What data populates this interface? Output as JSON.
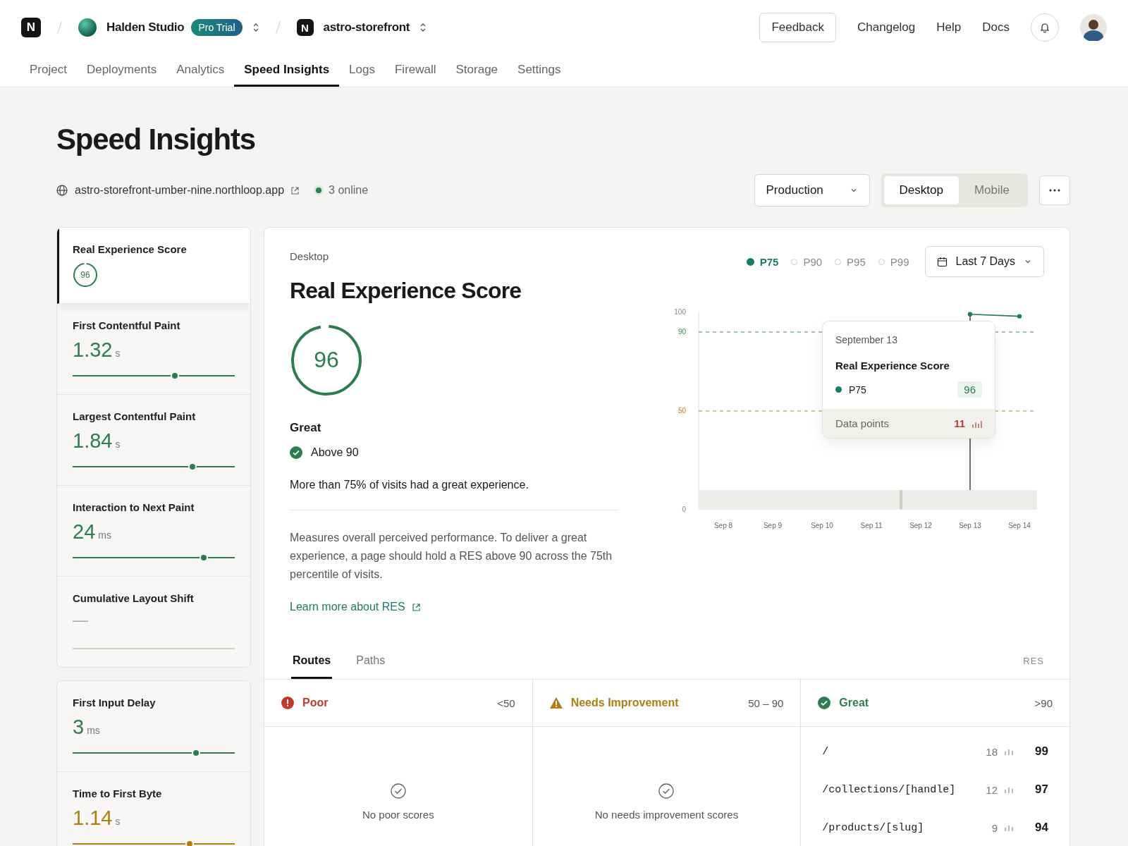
{
  "header": {
    "workspace": {
      "logo": "N",
      "name": "Halden Studio",
      "badge": "Pro Trial"
    },
    "project": {
      "logo": "N",
      "name": "astro-storefront"
    },
    "actions": [
      {
        "label": "Feedback",
        "kind": "outlined"
      },
      {
        "label": "Changelog",
        "kind": "plain"
      },
      {
        "label": "Help",
        "kind": "plain"
      },
      {
        "label": "Docs",
        "kind": "plain"
      }
    ]
  },
  "nav": [
    {
      "label": "Project",
      "selected": false
    },
    {
      "label": "Deployments",
      "selected": false
    },
    {
      "label": "Analytics",
      "selected": false
    },
    {
      "label": "Speed Insights",
      "selected": true
    },
    {
      "label": "Logs",
      "selected": false
    },
    {
      "label": "Firewall",
      "selected": false
    },
    {
      "label": "Storage",
      "selected": false
    },
    {
      "label": "Settings",
      "selected": false
    }
  ],
  "page": {
    "title": "Speed Insights",
    "url": "astro-storefront-umber-nine.northloop.app",
    "online": "3 online",
    "environment": "Production",
    "devices": [
      {
        "label": "Desktop",
        "selected": true
      },
      {
        "label": "Mobile",
        "selected": false
      }
    ]
  },
  "metric_groups": [
    {
      "items": [
        {
          "kind": "score",
          "name": "Real Experience Score",
          "score": "96",
          "level": 0.96,
          "selected": true
        },
        {
          "kind": "metric",
          "name": "First Contentful Paint",
          "value": "1.32",
          "unit": "s",
          "color": "#2e7d4f",
          "level": 0.63,
          "selected": false
        },
        {
          "kind": "metric",
          "name": "Largest Contentful Paint",
          "value": "1.84",
          "unit": "s",
          "color": "#2e7d4f",
          "level": 0.74,
          "selected": false
        },
        {
          "kind": "metric",
          "name": "Interaction to Next Paint",
          "value": "24",
          "unit": "ms",
          "color": "#2e7d4f",
          "level": 0.81,
          "selected": false
        },
        {
          "kind": "empty",
          "name": "Cumulative Layout Shift",
          "value": "—",
          "selected": false
        }
      ]
    },
    {
      "items": [
        {
          "kind": "metric",
          "name": "First Input Delay",
          "value": "3",
          "unit": "ms",
          "color": "#2e7d4f",
          "level": 0.76,
          "selected": false
        },
        {
          "kind": "metric",
          "name": "Time to First Byte",
          "value": "1.14",
          "unit": "s",
          "color": "#b07d10",
          "level": 0.72,
          "selected": false
        }
      ]
    }
  ],
  "detail": {
    "device": "Desktop",
    "title": "Real Experience Score",
    "score": "96",
    "level": 0.96,
    "rating": "Great",
    "threshold": "Above 90",
    "summary": "More than 75% of visits had a great experience.",
    "description": "Measures overall perceived performance. To deliver a great experience, a page should hold a RES above 90 across the 75th percentile of visits.",
    "link": "Learn more about RES",
    "percentiles": [
      {
        "label": "P75",
        "selected": true
      },
      {
        "label": "P90",
        "selected": false
      },
      {
        "label": "P95",
        "selected": false
      },
      {
        "label": "P99",
        "selected": false
      }
    ],
    "range": "Last 7 Days",
    "chart_data": {
      "type": "line",
      "categories": [
        "Sep 8",
        "Sep 9",
        "Sep 10",
        "Sep 11",
        "Sep 12",
        "Sep 13",
        "Sep 14"
      ],
      "series": [
        {
          "name": "P75",
          "color": "#1b7a68",
          "marker": "o",
          "values": [
            null,
            null,
            null,
            null,
            null,
            99,
            98
          ]
        }
      ],
      "ylim": [
        0,
        100
      ],
      "yticks": [
        0,
        50,
        90,
        100
      ],
      "ref_lines": [
        {
          "axis": "y",
          "value": 90,
          "color": "#3a8d5c"
        },
        {
          "axis": "y",
          "value": 50,
          "color": "#b8861b"
        },
        {
          "axis": "x",
          "value": "Sep 13",
          "color": "#111111"
        }
      ]
    },
    "tooltip": {
      "date": "September 13",
      "title": "Real Experience Score",
      "value": "96",
      "footer_label": "Data points",
      "footer_value": "11"
    }
  },
  "routes": {
    "tabs": [
      {
        "label": "Routes",
        "selected": true
      },
      {
        "label": "Paths",
        "selected": false
      }
    ],
    "column_label": "RES",
    "groups": [
      {
        "kind": "poor",
        "label": "Poor",
        "range": "<50",
        "empty": "No poor scores"
      },
      {
        "kind": "needs",
        "label": "Needs Improvement",
        "range": "50 – 90",
        "empty": "No needs improvement scores"
      },
      {
        "kind": "great",
        "label": "Great",
        "range": ">90",
        "rows": [
          {
            "path": "/",
            "count": "18",
            "score": "99"
          },
          {
            "path": "/collections/[handle]",
            "count": "12",
            "score": "97"
          },
          {
            "path": "/products/[slug]",
            "count": "9",
            "score": "94"
          }
        ]
      }
    ]
  }
}
